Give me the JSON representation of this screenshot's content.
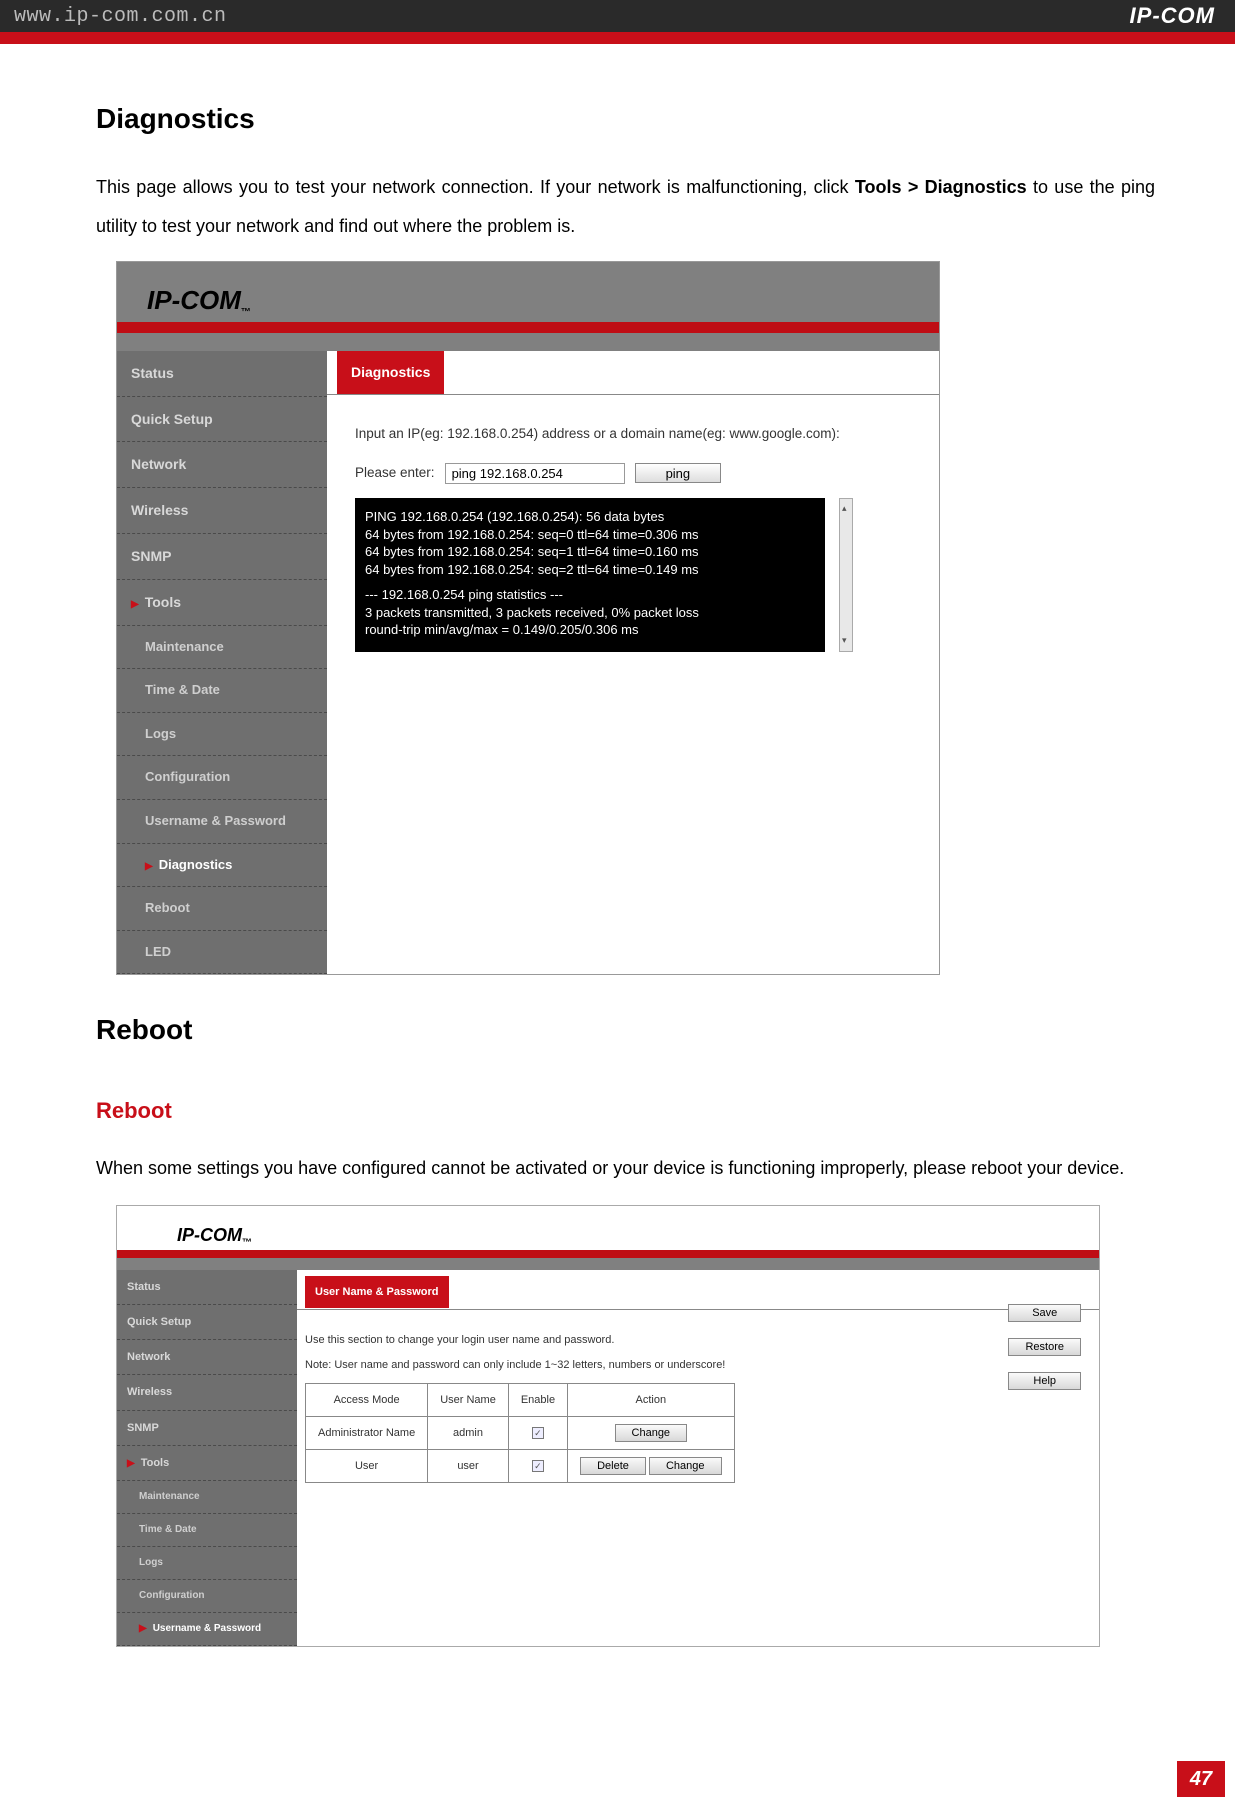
{
  "topbar": {
    "url": "www.ip-com.com.cn",
    "logo": "IP-COM"
  },
  "doc": {
    "h1a": "Diagnostics",
    "p1_pre": "This page allows you to test your network connection. If your network is malfunctioning, click ",
    "p1_b1": "Tools > ",
    "p1_b2": "Diagnostics",
    "p1_post": " to use the ping utility to test your network and find out where the problem is.",
    "h1b": "Reboot",
    "h2": "Reboot",
    "p2": "When some settings you have configured cannot be activated or your device is functioning improperly, please reboot your device."
  },
  "shot1": {
    "logo": "IP-COM",
    "tm": "™",
    "side": {
      "status": "Status",
      "quick": "Quick Setup",
      "network": "Network",
      "wireless": "Wireless",
      "snmp": "SNMP",
      "tools": "Tools",
      "maintenance": "Maintenance",
      "timedate": "Time & Date",
      "logs": "Logs",
      "config": "Configuration",
      "userpass": "Username & Password",
      "diag": "Diagnostics",
      "reboot": "Reboot",
      "led": "LED"
    },
    "tab": "Diagnostics",
    "instr": "Input an IP(eg: 192.168.0.254) address or a domain name(eg: www.google.com):",
    "enter_label": "Please enter:",
    "input_value": "ping 192.168.0.254",
    "ping_btn": "ping",
    "term": {
      "l0": "PING 192.168.0.254 (192.168.0.254): 56 data bytes",
      "l1": "64 bytes from 192.168.0.254: seq=0 ttl=64 time=0.306 ms",
      "l2": "64 bytes from 192.168.0.254: seq=1 ttl=64 time=0.160 ms",
      "l3": "64 bytes from 192.168.0.254: seq=2 ttl=64 time=0.149 ms",
      "l4": "--- 192.168.0.254 ping statistics ---",
      "l5": "3 packets transmitted, 3 packets received, 0% packet loss",
      "l6": "round-trip min/avg/max = 0.149/0.205/0.306 ms"
    }
  },
  "shot2": {
    "logo": "IP-COM",
    "tm": "™",
    "url": "www.ip-com.com.cn",
    "side": {
      "status": "Status",
      "quick": "Quick Setup",
      "network": "Network",
      "wireless": "Wireless",
      "snmp": "SNMP",
      "tools": "Tools",
      "maintenance": "Maintenance",
      "timedate": "Time & Date",
      "logs": "Logs",
      "config": "Configuration",
      "userpass": "Username & Password"
    },
    "tab": "User Name & Password",
    "line1": "Use this section to change your login user name and password.",
    "line2": "Note: User name and password can only include 1~32 letters, numbers or underscore!",
    "th": {
      "mode": "Access Mode",
      "user": "User Name",
      "enable": "Enable",
      "action": "Action"
    },
    "r1": {
      "mode": "Administrator Name",
      "user": "admin",
      "change": "Change"
    },
    "r2": {
      "mode": "User",
      "user": "user",
      "delete": "Delete",
      "change": "Change"
    },
    "btns": {
      "save": "Save",
      "restore": "Restore",
      "help": "Help"
    }
  },
  "page_number": "47"
}
